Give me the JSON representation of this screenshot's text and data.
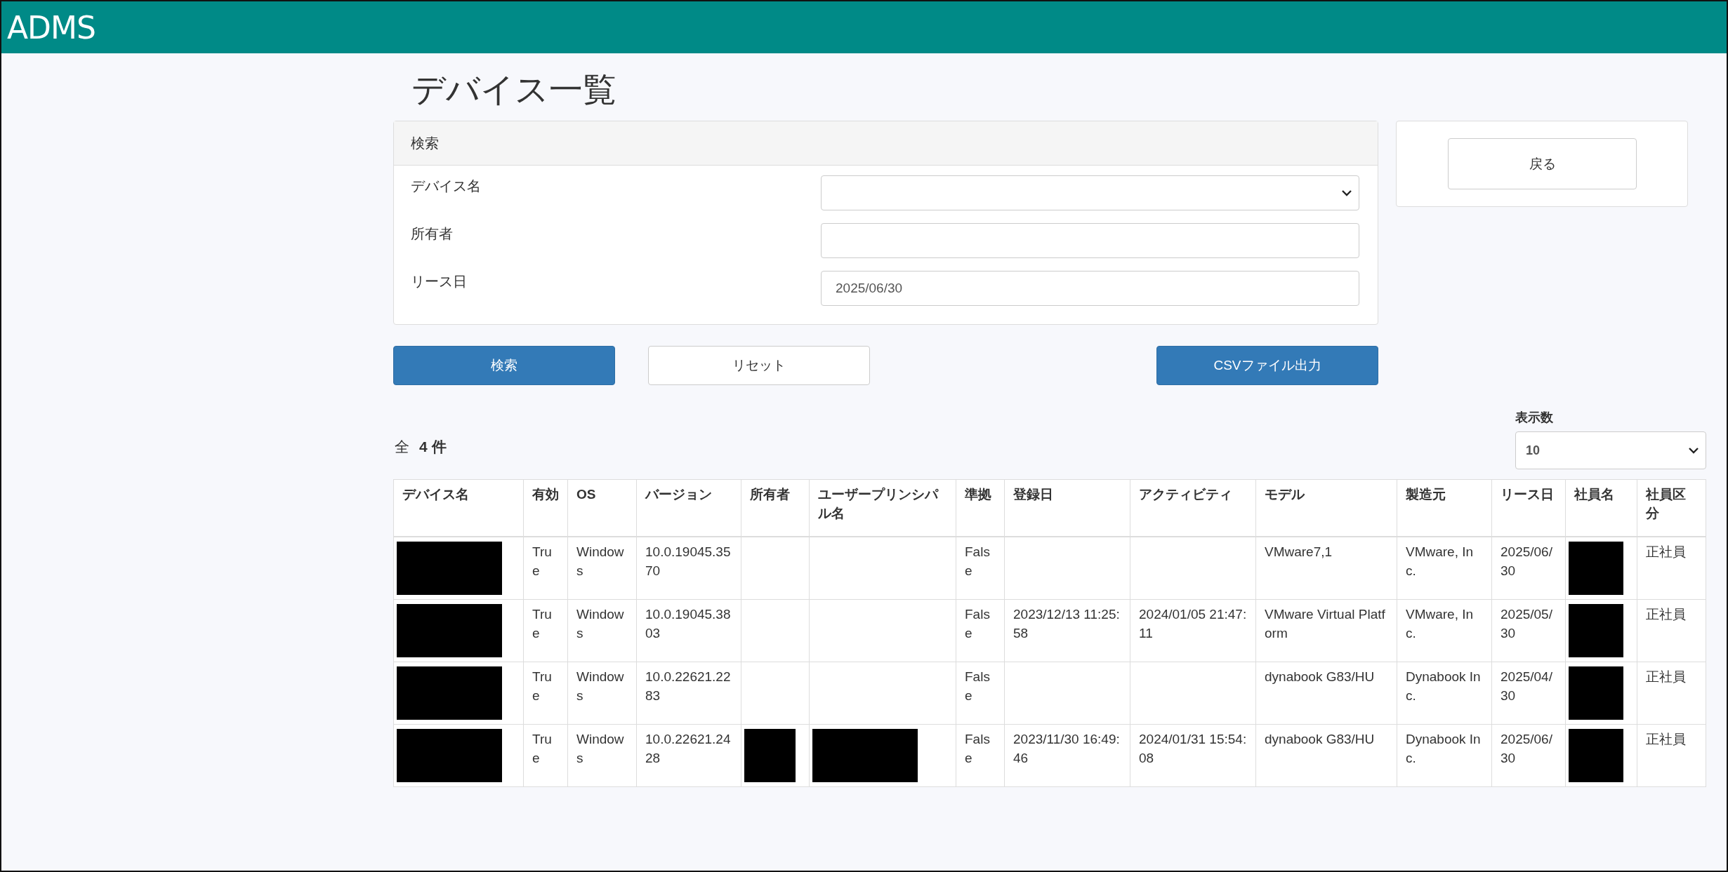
{
  "header": {
    "logo": "ADMS"
  },
  "page_title": "デバイス一覧",
  "search": {
    "title": "検索",
    "fields": [
      {
        "label": "デバイス名",
        "kind": "select"
      },
      {
        "label": "所有者",
        "kind": "text"
      },
      {
        "label": "リース日",
        "kind": "text",
        "value": "2025/06/30"
      }
    ]
  },
  "back_button": "戻る",
  "actions": [
    {
      "label": "検索",
      "kind": "primary"
    },
    {
      "label": "リセット",
      "kind": "default"
    },
    {
      "label": "CSVファイル出力",
      "kind": "primary"
    }
  ],
  "page_size": {
    "label": "表示数",
    "value": "10"
  },
  "total": {
    "prefix": "全",
    "count": "4",
    "suffix": "件"
  },
  "table": {
    "columns": [
      "デバイス名",
      "有効",
      "OS",
      "バージョン",
      "所有者",
      "ユーザープリンシパル名",
      "準拠",
      "登録日",
      "アクティビティ",
      "モデル",
      "製造元",
      "リース日",
      "社員名",
      "社員区分"
    ],
    "rows": [
      {
        "cells": [
          {
            "kind": "redacted"
          },
          {
            "kind": "text",
            "text": "True"
          },
          {
            "kind": "text",
            "text": "Windows"
          },
          {
            "kind": "text",
            "text": "10.0.19045.3570"
          },
          {
            "kind": "empty"
          },
          {
            "kind": "empty"
          },
          {
            "kind": "text",
            "text": "False"
          },
          {
            "kind": "empty"
          },
          {
            "kind": "empty"
          },
          {
            "kind": "text",
            "text": "VMware7,1"
          },
          {
            "kind": "text",
            "text": "VMware, Inc."
          },
          {
            "kind": "text",
            "text": "2025/06/30"
          },
          {
            "kind": "redacted"
          },
          {
            "kind": "text",
            "text": "正社員"
          }
        ]
      },
      {
        "cells": [
          {
            "kind": "redacted"
          },
          {
            "kind": "text",
            "text": "True"
          },
          {
            "kind": "text",
            "text": "Windows"
          },
          {
            "kind": "text",
            "text": "10.0.19045.3803"
          },
          {
            "kind": "empty"
          },
          {
            "kind": "empty"
          },
          {
            "kind": "text",
            "text": "False"
          },
          {
            "kind": "text",
            "text": "2023/12/13 11:25:58"
          },
          {
            "kind": "text",
            "text": "2024/01/05 21:47:11"
          },
          {
            "kind": "text",
            "text": "VMware Virtual Platform"
          },
          {
            "kind": "text",
            "text": "VMware, Inc."
          },
          {
            "kind": "text",
            "text": "2025/05/30"
          },
          {
            "kind": "redacted"
          },
          {
            "kind": "text",
            "text": "正社員"
          }
        ]
      },
      {
        "cells": [
          {
            "kind": "redacted"
          },
          {
            "kind": "text",
            "text": "True"
          },
          {
            "kind": "text",
            "text": "Windows"
          },
          {
            "kind": "text",
            "text": "10.0.22621.2283"
          },
          {
            "kind": "empty"
          },
          {
            "kind": "empty"
          },
          {
            "kind": "text",
            "text": "False"
          },
          {
            "kind": "empty"
          },
          {
            "kind": "empty"
          },
          {
            "kind": "text",
            "text": "dynabook G83/HU"
          },
          {
            "kind": "text",
            "text": "Dynabook Inc."
          },
          {
            "kind": "text",
            "text": "2025/04/30"
          },
          {
            "kind": "redacted"
          },
          {
            "kind": "text",
            "text": "正社員"
          }
        ]
      },
      {
        "cells": [
          {
            "kind": "redacted"
          },
          {
            "kind": "text",
            "text": "True"
          },
          {
            "kind": "text",
            "text": "Windows"
          },
          {
            "kind": "text",
            "text": "10.0.22621.2428"
          },
          {
            "kind": "redacted"
          },
          {
            "kind": "redacted"
          },
          {
            "kind": "text",
            "text": "False"
          },
          {
            "kind": "text",
            "text": "2023/11/30 16:49:46"
          },
          {
            "kind": "text",
            "text": "2024/01/31 15:54:08"
          },
          {
            "kind": "text",
            "text": "dynabook G83/HU"
          },
          {
            "kind": "text",
            "text": "Dynabook Inc."
          },
          {
            "kind": "text",
            "text": "2025/06/30"
          },
          {
            "kind": "redacted"
          },
          {
            "kind": "text",
            "text": "正社員"
          }
        ]
      }
    ]
  }
}
